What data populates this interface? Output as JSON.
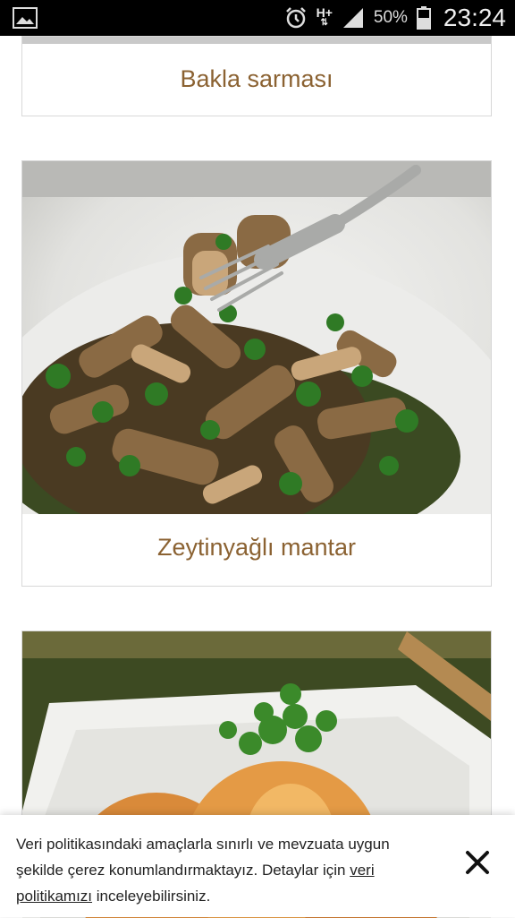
{
  "status_bar": {
    "network": "H+",
    "battery": "50%",
    "time": "23:24"
  },
  "recipes": [
    {
      "title": "Bakla sarması"
    },
    {
      "title": "Zeytinyağlı mantar"
    },
    {
      "title": ""
    }
  ],
  "cookie_banner": {
    "text_before": "Veri politikasındaki amaçlarla sınırlı ve mevzuata uygun şekilde çerez konumlandırmaktayız. Detaylar için ",
    "link_text": "veri politikamızı",
    "text_after": " inceleyebilirsiniz."
  },
  "colors": {
    "title": "#8b6232",
    "status_bar": "#000000"
  }
}
